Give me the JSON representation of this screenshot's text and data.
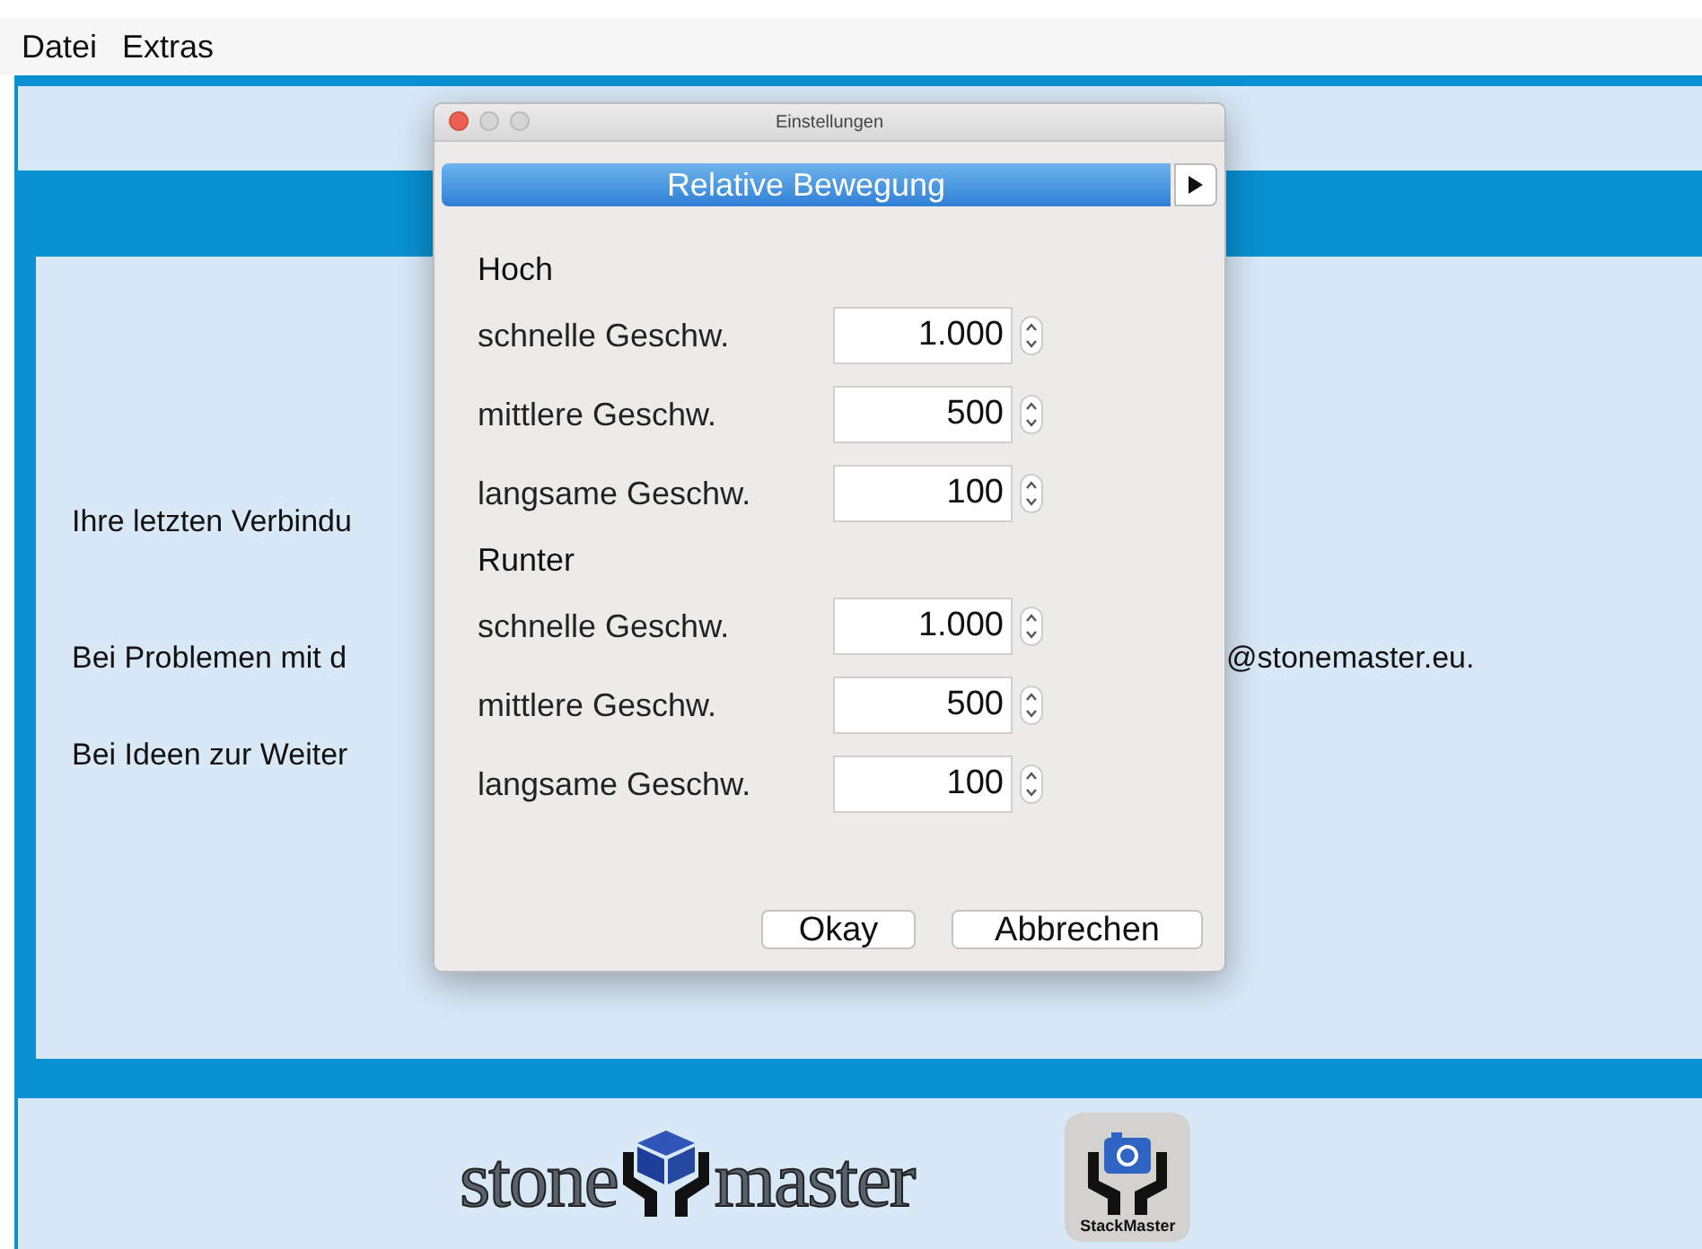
{
  "menu": [
    {
      "label": "Datei"
    },
    {
      "label": "Extras"
    }
  ],
  "main": {
    "lines": [
      {
        "left": "Ihre letzten Verbindu"
      },
      {
        "left": "Bei Problemen mit d",
        "right": "@stonemaster.eu."
      },
      {
        "left": "Bei Ideen zur Weiter"
      }
    ]
  },
  "footer": {
    "logo_left": "stone",
    "logo_right": "master",
    "app_label": "StackMaster"
  },
  "dialog": {
    "title": "Einstellungen",
    "mode": "Relative Bewegung",
    "groups": [
      {
        "heading": "Hoch",
        "fields": [
          {
            "label": "schnelle Geschw.",
            "value": "1.000"
          },
          {
            "label": "mittlere Geschw.",
            "value": "500"
          },
          {
            "label": "langsame Geschw.",
            "value": "100"
          }
        ]
      },
      {
        "heading": "Runter",
        "fields": [
          {
            "label": "schnelle Geschw.",
            "value": "1.000"
          },
          {
            "label": "mittlere Geschw.",
            "value": "500"
          },
          {
            "label": "langsame Geschw.",
            "value": "100"
          }
        ]
      }
    ],
    "buttons": [
      "Okay",
      "Abbrechen"
    ]
  }
}
